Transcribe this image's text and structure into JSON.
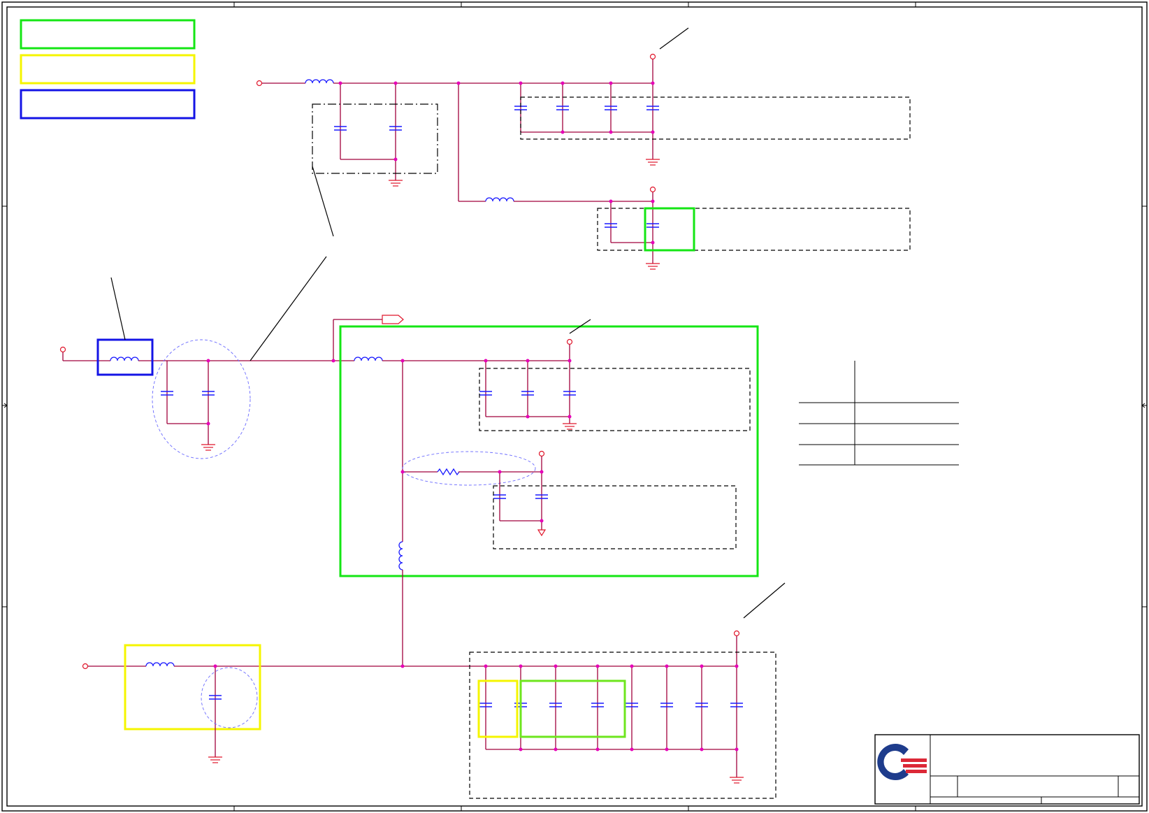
{
  "colors": {
    "wire": "#a0003c",
    "component": "#1a1aff",
    "ground": "#e0162b",
    "junction": "#e600b8",
    "highlight_green": "#14e614",
    "highlight_yellow": "#f5f500",
    "highlight_blue": "#1414e6",
    "logo_blue": "#1e3c8c",
    "logo_red": "#dc2837"
  },
  "icons": {
    "company_logo": "quanta-logo-icon",
    "capacitor": "capacitor-icon",
    "inductor": "inductor-icon",
    "resistor": "resistor-icon",
    "ground": "ground-icon",
    "power_port": "power-port-icon",
    "offpage_connector": "offpage-connector-icon"
  }
}
